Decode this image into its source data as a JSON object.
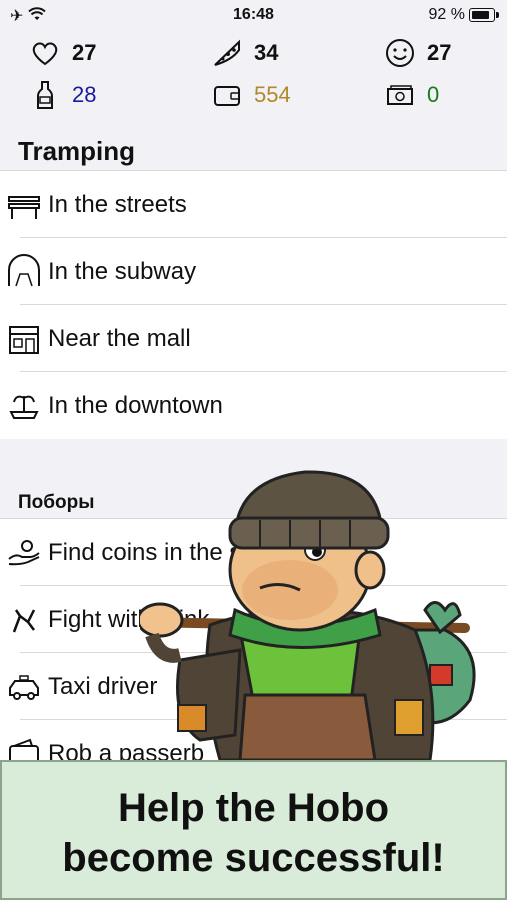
{
  "status": {
    "time": "16:48",
    "battery": "92 %",
    "icons": [
      "airplane-icon",
      "wifi-icon",
      "battery-icon"
    ]
  },
  "stats": [
    {
      "icon": "heart-icon",
      "value": "27",
      "color": "#111"
    },
    {
      "icon": "pizza-icon",
      "value": "34",
      "color": "#111"
    },
    {
      "icon": "smile-icon",
      "value": "27",
      "color": "#111"
    },
    {
      "icon": "bottle-icon",
      "value": "28",
      "color": "#1a1a9a"
    },
    {
      "icon": "wallet-icon",
      "value": "554",
      "color": "#b0892b"
    },
    {
      "icon": "money-icon",
      "value": "0",
      "color": "#1a7a1a"
    }
  ],
  "tramping": {
    "title": "Tramping",
    "items": [
      {
        "label": "In the streets",
        "icon": "bench-icon"
      },
      {
        "label": "In the subway",
        "icon": "subway-icon"
      },
      {
        "label": "Near the mall",
        "icon": "mall-icon"
      },
      {
        "label": "In the downtown",
        "icon": "fountain-icon"
      }
    ]
  },
  "pobory": {
    "title": "Поборы",
    "items": [
      {
        "label": "Find coins in the s",
        "icon": "hand-coin-icon"
      },
      {
        "label": "Fight with drink",
        "icon": "fight-icon"
      },
      {
        "label": "Taxi driver",
        "icon": "taxi-icon"
      },
      {
        "label": "Rob a passerb",
        "icon": "wallet-rob-icon"
      }
    ]
  },
  "banner": {
    "line1": "Help the Hobo",
    "line2": "become successful!"
  }
}
